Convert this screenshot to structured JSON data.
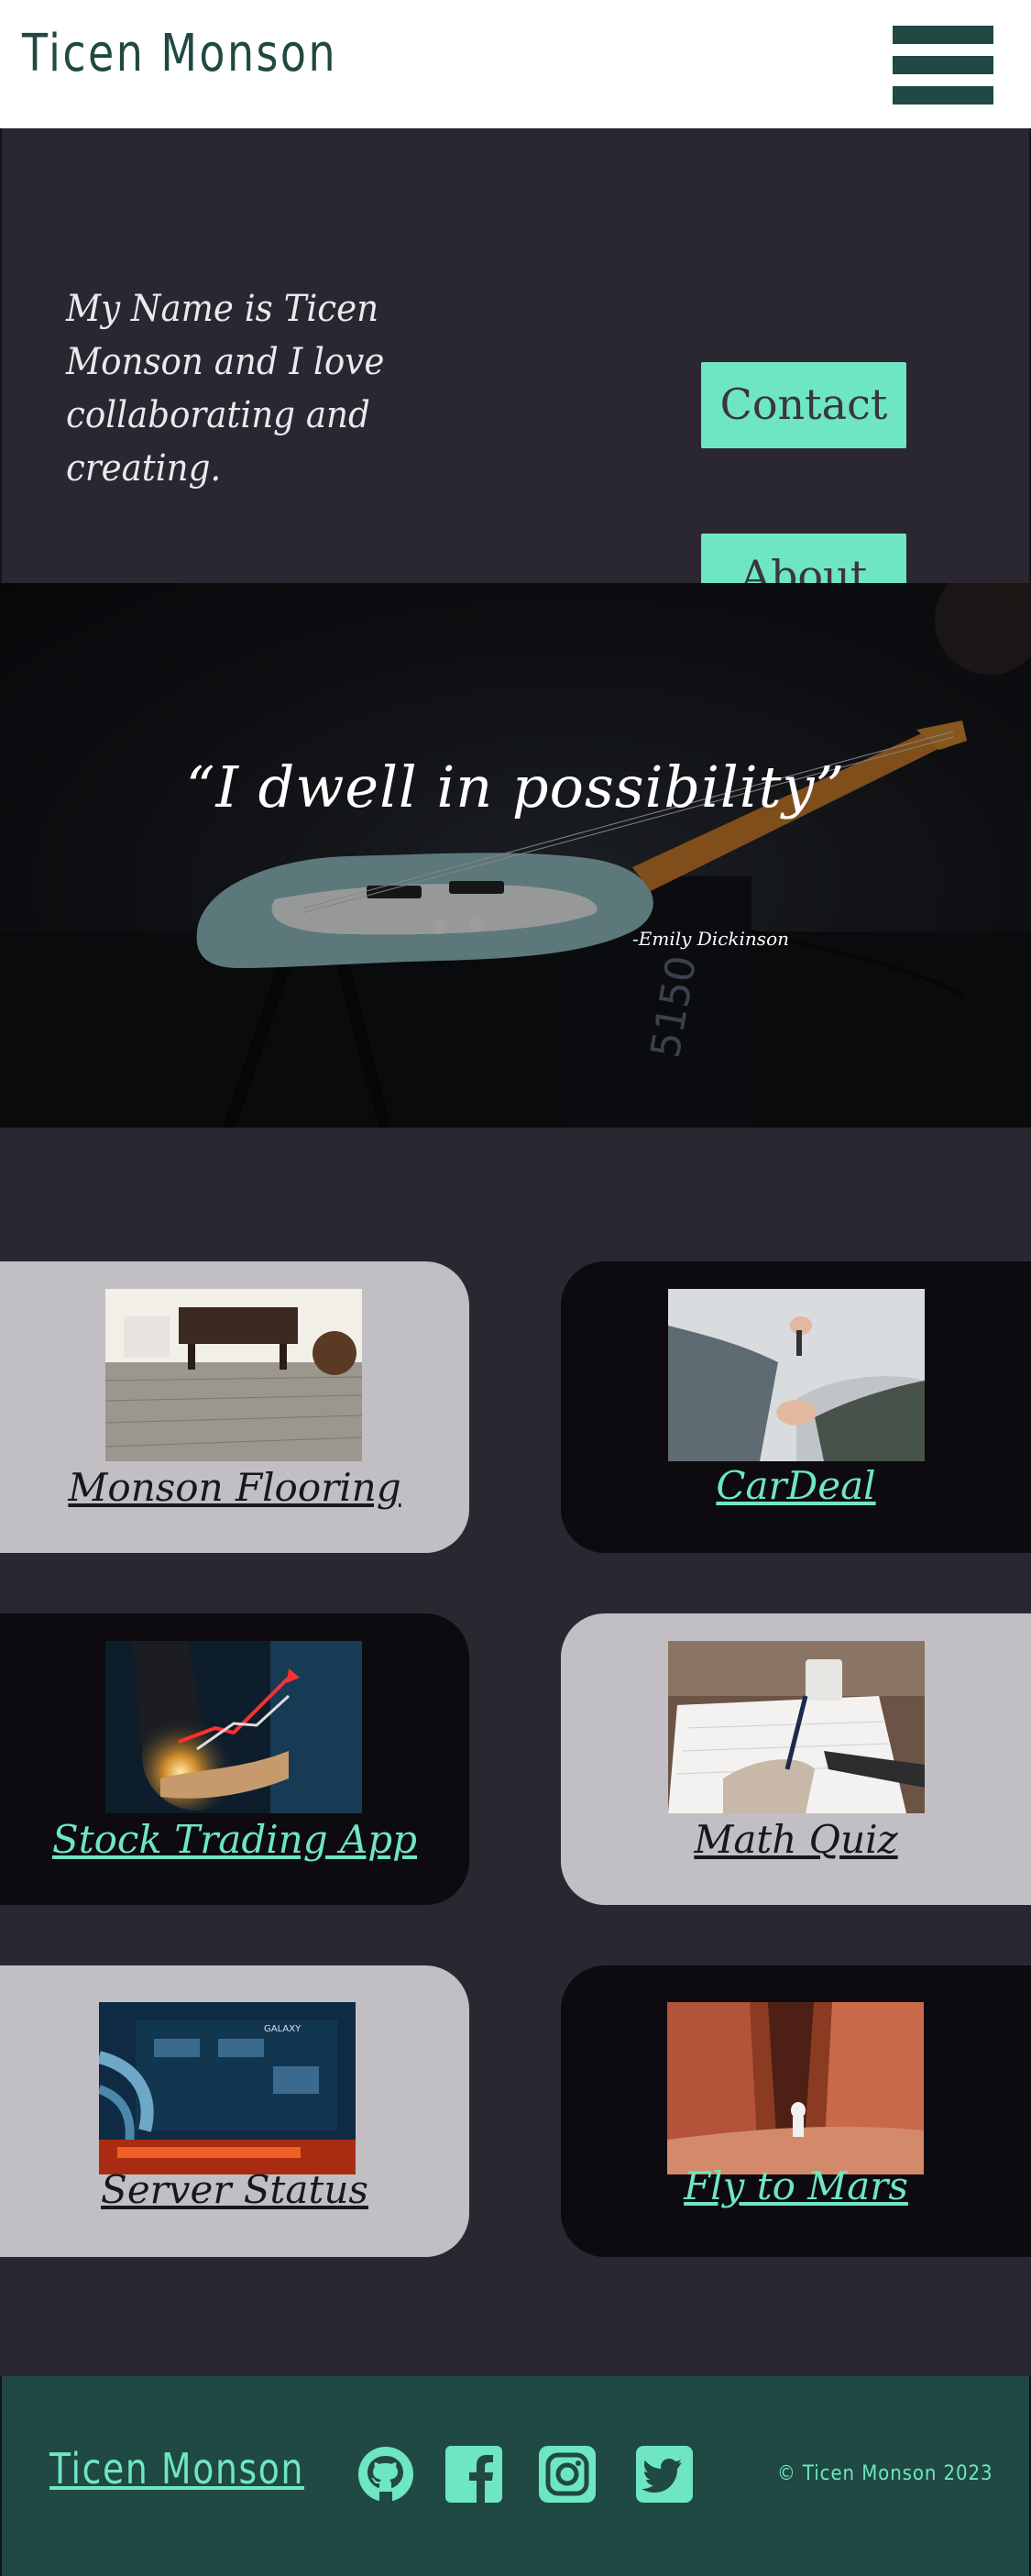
{
  "header": {
    "brand": "Ticen Monson",
    "menu_icon": "hamburger-menu-icon"
  },
  "intro": {
    "text": "My Name is Ticen Monson and I love collaborating and creating.",
    "contact_label": "Contact",
    "about_label": "About"
  },
  "hero": {
    "quote": "“I dwell in possibility”",
    "author": "-Emily Dickinson"
  },
  "projects": [
    {
      "title": "Monson Flooring",
      "theme": "light",
      "image": "wood-floor-photo"
    },
    {
      "title": "CarDeal",
      "theme": "dark",
      "image": "handshake-car-keys-photo"
    },
    {
      "title": "Stock Trading App",
      "theme": "dark",
      "image": "stock-chart-hand-photo"
    },
    {
      "title": "Math Quiz",
      "theme": "light",
      "image": "writing-notebook-photo"
    },
    {
      "title": "Server Status",
      "theme": "light",
      "image": "server-hardware-photo"
    },
    {
      "title": "Fly to Mars",
      "theme": "dark",
      "image": "astronaut-canyon-photo"
    }
  ],
  "footer": {
    "brand": "Ticen Monson",
    "copyright": "© Ticen Monson 2023",
    "social_icons": [
      "github-icon",
      "facebook-icon",
      "instagram-icon",
      "twitter-icon"
    ]
  },
  "colors": {
    "accent": "#6ee6c3",
    "brand_dark": "#1f4942",
    "background": "#2b2730",
    "card_light": "#c2bfc4",
    "card_dark": "#0d0b0f"
  }
}
